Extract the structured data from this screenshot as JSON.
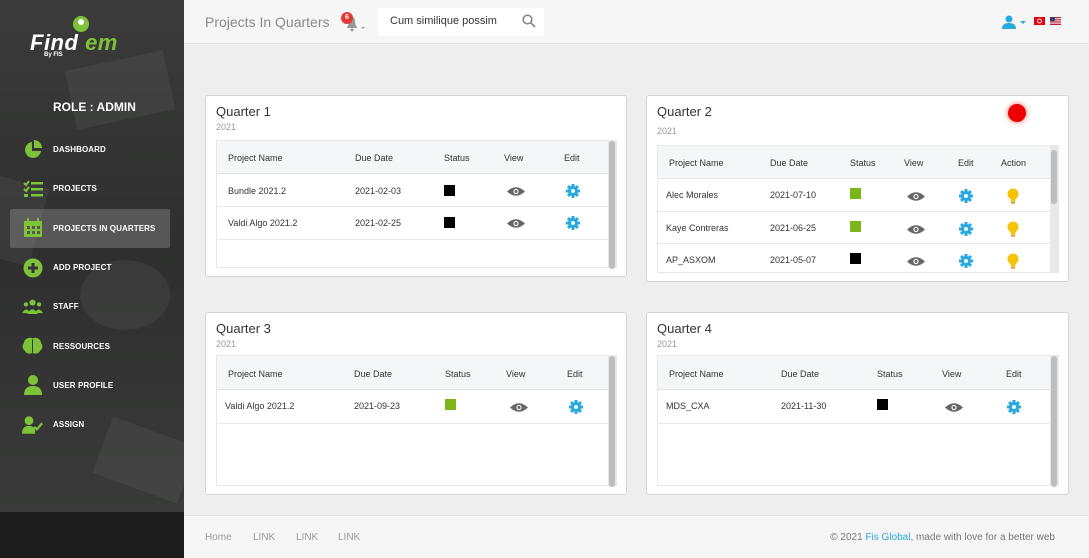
{
  "brand": {
    "name_a": "Find",
    "name_b": "em",
    "by": "By FIS"
  },
  "role": "ROLE : ADMIN",
  "sidebar": {
    "items": [
      {
        "label": "DASHBOARD",
        "icon": "pie-chart-icon"
      },
      {
        "label": "PROJECTS",
        "icon": "checklist-icon"
      },
      {
        "label": "PROJECTS IN QUARTERS",
        "icon": "calendar-icon",
        "active": true
      },
      {
        "label": "ADD PROJECT",
        "icon": "plus-circle-icon"
      },
      {
        "label": "STAFF",
        "icon": "group-icon"
      },
      {
        "label": "RESSOURCES",
        "icon": "brain-icon"
      },
      {
        "label": "USER PROFILE",
        "icon": "user-icon"
      },
      {
        "label": "ASSIGN",
        "icon": "user-check-icon"
      }
    ]
  },
  "header": {
    "title": "Projects In Quarters",
    "notifications": "6",
    "search_value": "Cum similique possim"
  },
  "colors": {
    "accent": "#7ec23a",
    "info": "#29a8e0",
    "warning": "#f5c400",
    "status_green": "#7cb518",
    "status_black": "#000000"
  },
  "columns": {
    "name": "Project Name",
    "due": "Due Date",
    "status": "Status",
    "view": "View",
    "edit": "Edit",
    "action": "Action"
  },
  "quarters": [
    {
      "title": "Quarter 1",
      "year": "2021",
      "rows": [
        {
          "name": "Bundle 2021.2",
          "due": "2021-02-03",
          "status": "black"
        },
        {
          "name": "Valdi Algo 2021.2",
          "due": "2021-02-25",
          "status": "black"
        }
      ]
    },
    {
      "title": "Quarter 2",
      "year": "2021",
      "rows": [
        {
          "name": "Alec Morales",
          "due": "2021-07-10",
          "status": "green"
        },
        {
          "name": "Kaye Contreras",
          "due": "2021-06-25",
          "status": "green"
        },
        {
          "name": "AP_ASXOM",
          "due": "2021-05-07",
          "status": "black"
        }
      ]
    },
    {
      "title": "Quarter 3",
      "year": "2021",
      "rows": [
        {
          "name": "Valdi Algo 2021.2",
          "due": "2021-09-23",
          "status": "green"
        }
      ]
    },
    {
      "title": "Quarter 4",
      "year": "2021",
      "rows": [
        {
          "name": "MDS_CXA",
          "due": "2021-11-30",
          "status": "black"
        }
      ]
    }
  ],
  "footer": {
    "links": [
      "Home",
      "LINK",
      "LINK",
      "LINK"
    ],
    "copy_prefix": "© 2021",
    "copy_brand": "Fis Global",
    "copy_suffix": ", made with love for a better web"
  }
}
